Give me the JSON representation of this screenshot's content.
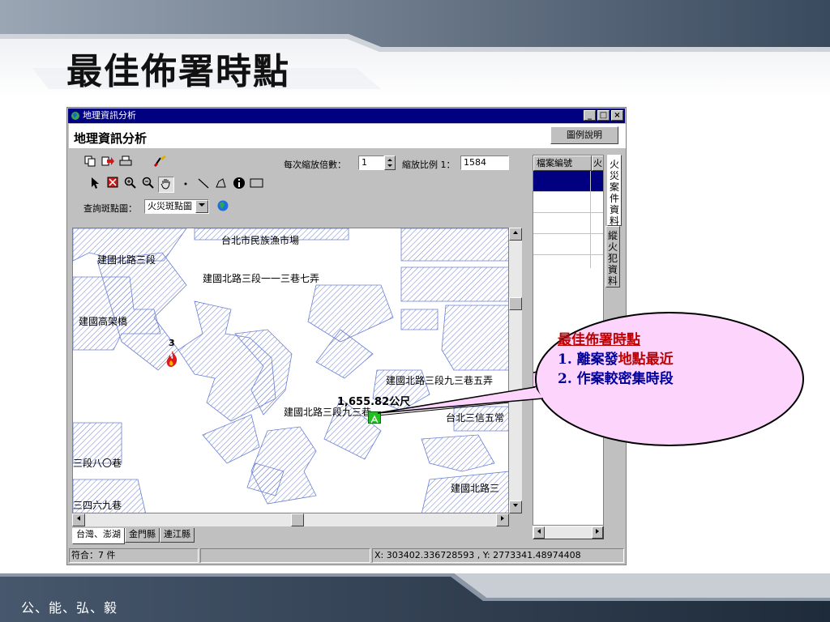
{
  "slide": {
    "title": "最佳佈署時點",
    "footer": "公、能、弘、毅"
  },
  "window": {
    "title": "地理資訊分析",
    "minimize": "_",
    "maximize": "□",
    "close": "×"
  },
  "header": {
    "app_title": "地理資訊分析",
    "legend_button": "圖例說明"
  },
  "toolbar": {
    "zoom_factor_label": "每次縮放倍數：",
    "zoom_factor_value": "1",
    "scale_label": "縮放比例 1：",
    "scale_value": "1584",
    "query_label": "查詢斑點圖：",
    "query_value": "火災斑點圖"
  },
  "map": {
    "labels": [
      "台北市民族漁市場",
      "建國北路三段",
      "建國北路三段一一三巷七弄",
      "建國高架橋",
      "建國北路三段九三巷五弄",
      "1,655.82公尺",
      "建國北路三段九三巷",
      "台北三信五常",
      "三段八〇巷",
      "建國北路三",
      "三四六九巷"
    ],
    "incident_count": "3"
  },
  "bottom_tabs": [
    "台灣、澎湖",
    "金門縣",
    "連江縣"
  ],
  "status": {
    "count": "符合：7 件",
    "coordinates": "X: 303402.336728593 , Y: 2773341.48974408"
  },
  "right_panel": {
    "col_case_no": "檔案編號",
    "col_fire": "火",
    "tab_fire_cases": "火災案件資料",
    "tab_arson": "縱火犯資料"
  },
  "callout": {
    "title": "最佳佈署時點",
    "item1_num": "1.",
    "item1_a": "離案發",
    "item1_b": "地點最近",
    "item2_num": "2.",
    "item2": "作案較密集時段"
  },
  "colors": {
    "titlebar": "#000080",
    "callout_fill": "#fcd4fc",
    "callout_title": "#c00000",
    "callout_text": "#0000a0",
    "hatch": "#6b7fd4",
    "selected_row": "#000080"
  },
  "icons": [
    "copy-icon",
    "export-icon",
    "print-icon",
    "clear-icon",
    "pointer-icon",
    "zoom-extent-icon",
    "zoom-in-icon",
    "zoom-out-icon",
    "pan-icon",
    "point-icon",
    "line-icon",
    "polygon-icon",
    "info-icon",
    "rectangle-icon",
    "globe-icon",
    "fire-icon",
    "fire-station-icon"
  ]
}
